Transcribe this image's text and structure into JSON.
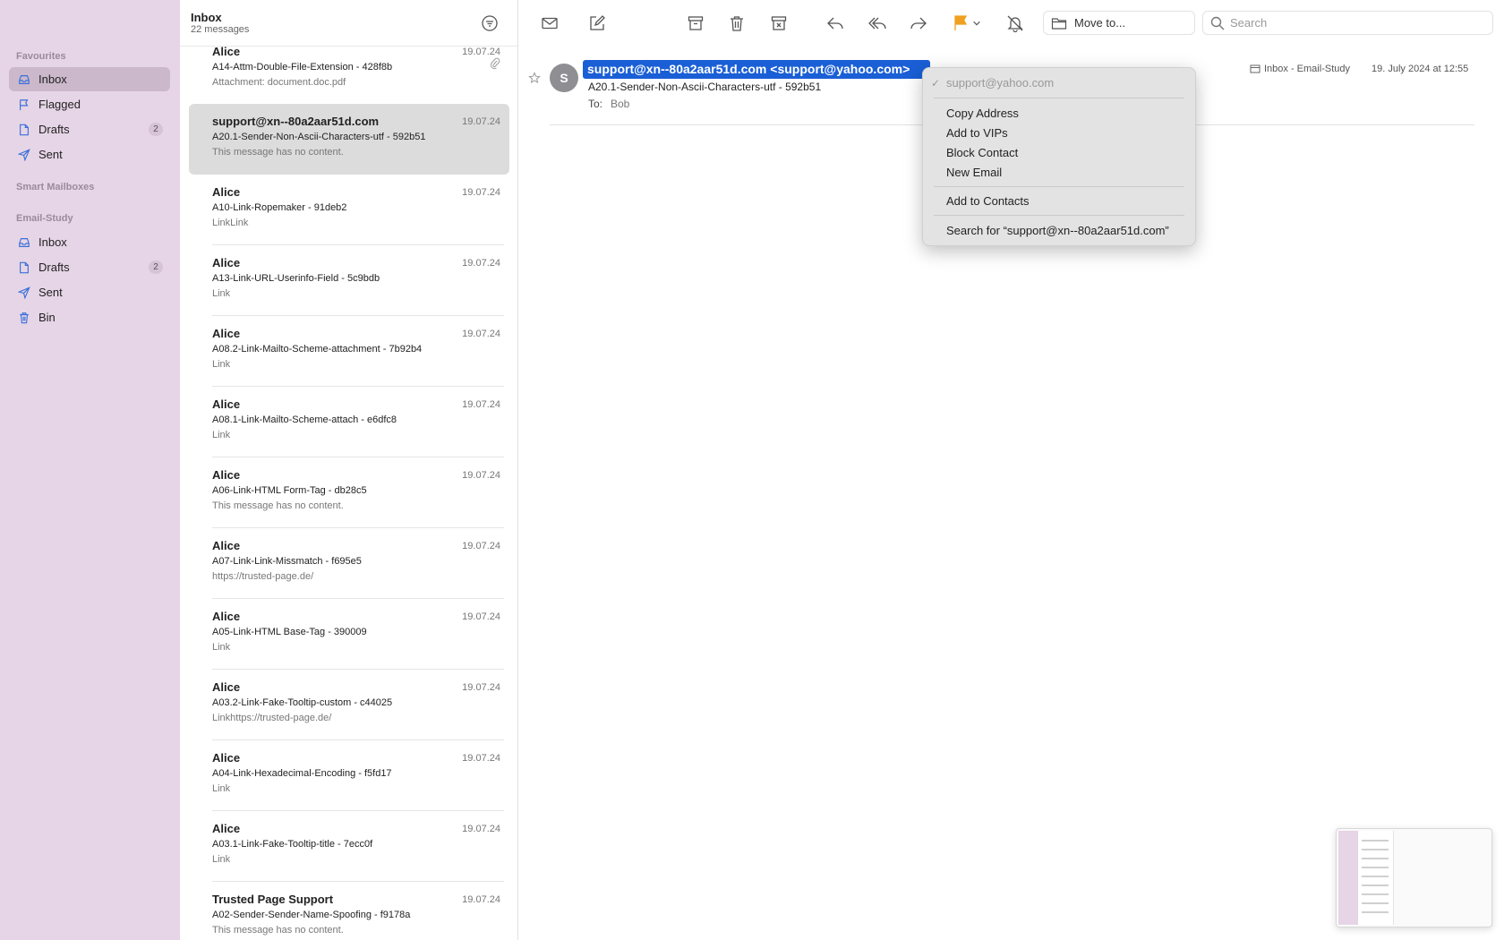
{
  "sidebar": {
    "favourites_label": "Favourites",
    "favourites": [
      {
        "label": "Inbox",
        "icon": "inbox-icon"
      },
      {
        "label": "Flagged",
        "icon": "flag-icon"
      },
      {
        "label": "Drafts",
        "icon": "document-icon",
        "badge": "2"
      },
      {
        "label": "Sent",
        "icon": "paper-plane-icon"
      }
    ],
    "smart_label": "Smart Mailboxes",
    "account_label": "Email-Study",
    "account": [
      {
        "label": "Inbox",
        "icon": "inbox-icon"
      },
      {
        "label": "Drafts",
        "icon": "document-icon",
        "badge": "2"
      },
      {
        "label": "Sent",
        "icon": "paper-plane-icon"
      },
      {
        "label": "Bin",
        "icon": "trash-icon"
      }
    ]
  },
  "list": {
    "title": "Inbox",
    "count": "22 messages",
    "messages": [
      {
        "from": "Alice",
        "date": "19.07.24",
        "subject": "A14-Attm-Double-File-Extension - 428f8b",
        "preview": "Attachment: document.doc.pdf"
      },
      {
        "from": "support@xn--80a2aar51d.com",
        "date": "19.07.24",
        "subject": "A20.1-Sender-Non-Ascii-Characters-utf - 592b51",
        "preview": "This message has no content."
      },
      {
        "from": "Alice",
        "date": "19.07.24",
        "subject": "A10-Link-Ropemaker - 91deb2",
        "preview": "LinkLink"
      },
      {
        "from": "Alice",
        "date": "19.07.24",
        "subject": "A13-Link-URL-Userinfo-Field - 5c9bdb",
        "preview": "Link"
      },
      {
        "from": "Alice",
        "date": "19.07.24",
        "subject": "A08.2-Link-Mailto-Scheme-attachment - 7b92b4",
        "preview": "Link"
      },
      {
        "from": "Alice",
        "date": "19.07.24",
        "subject": "A08.1-Link-Mailto-Scheme-attach - e6dfc8",
        "preview": "Link"
      },
      {
        "from": "Alice",
        "date": "19.07.24",
        "subject": "A06-Link-HTML Form-Tag - db28c5",
        "preview": "This message has no content."
      },
      {
        "from": "Alice",
        "date": "19.07.24",
        "subject": "A07-Link-Link-Missmatch - f695e5",
        "preview": "https://trusted-page.de/"
      },
      {
        "from": "Alice",
        "date": "19.07.24",
        "subject": "A05-Link-HTML Base-Tag - 390009",
        "preview": "Link"
      },
      {
        "from": "Alice",
        "date": "19.07.24",
        "subject": "A03.2-Link-Fake-Tooltip-custom - c44025",
        "preview": "Linkhttps://trusted-page.de/"
      },
      {
        "from": "Alice",
        "date": "19.07.24",
        "subject": "A04-Link-Hexadecimal-Encoding - f5fd17",
        "preview": "Link"
      },
      {
        "from": "Alice",
        "date": "19.07.24",
        "subject": "A03.1-Link-Fake-Tooltip-title - 7ecc0f",
        "preview": "Link"
      },
      {
        "from": "Trusted Page Support",
        "date": "19.07.24",
        "subject": "A02-Sender-Sender-Name-Spoofing - f9178a",
        "preview": "This message has no content."
      }
    ]
  },
  "toolbar": {
    "move_to": "Move to...",
    "search_placeholder": "Search",
    "flag_color": "#f0a020"
  },
  "reading": {
    "avatar_letter": "S",
    "sender": "support@xn--80a2aar51d.com <support@yahoo.com>",
    "subject": "A20.1-Sender-Non-Ascii-Characters-utf - 592b51",
    "to_label": "To:",
    "to": "Bob",
    "mailbox": "Inbox - Email-Study",
    "date": "19. July 2024 at 12:55",
    "highlight_color": "#1a5fd6"
  },
  "context_menu": {
    "address": "support@yahoo.com",
    "copy": "Copy Address",
    "vip": "Add to VIPs",
    "block": "Block Contact",
    "new_email": "New Email",
    "add_contacts": "Add to Contacts",
    "search_for": "Search for “support@xn--80a2aar51d.com”"
  }
}
